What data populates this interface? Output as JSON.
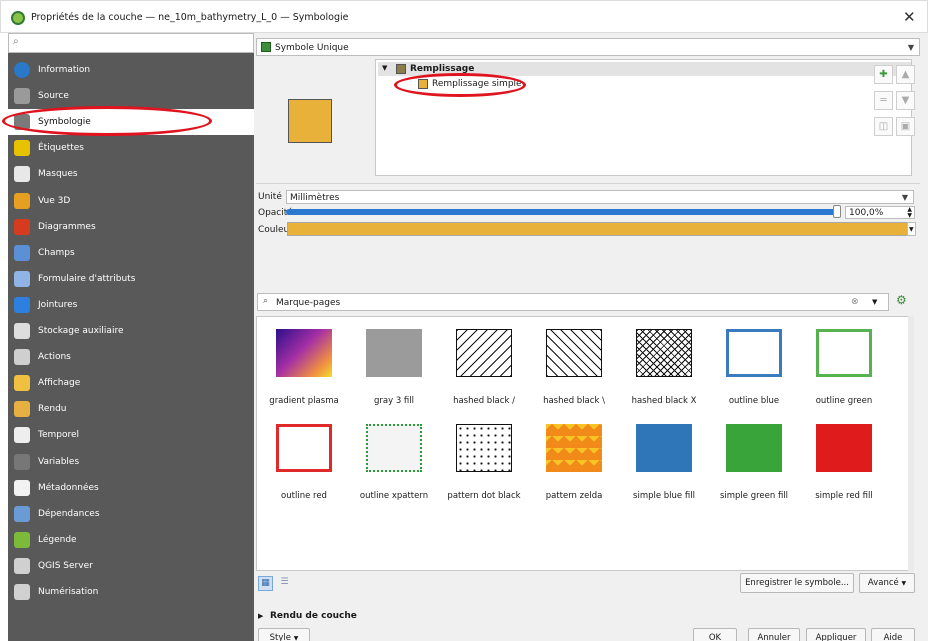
{
  "window": {
    "title": "Propriétés de la couche — ne_10m_bathymetry_L_0 — Symbologie",
    "close_glyph": "✕"
  },
  "sidebar": {
    "search_placeholder": "",
    "items": [
      {
        "label": "Information",
        "icon": "info-icon",
        "color": "#2a78c8"
      },
      {
        "label": "Source",
        "icon": "source-icon",
        "color": "#9a9a9a"
      },
      {
        "label": "Symbologie",
        "icon": "brush-icon",
        "color": "#7a7a7a",
        "selected": true
      },
      {
        "label": "Étiquettes",
        "icon": "labels-icon",
        "color": "#e6c200"
      },
      {
        "label": "Masques",
        "icon": "masks-icon",
        "color": "#e8e8e8"
      },
      {
        "label": "Vue 3D",
        "icon": "cube-icon",
        "color": "#e5a021"
      },
      {
        "label": "Diagrammes",
        "icon": "diagram-icon",
        "color": "#d63b1f"
      },
      {
        "label": "Champs",
        "icon": "fields-icon",
        "color": "#5b8fd6"
      },
      {
        "label": "Formulaire d'attributs",
        "icon": "form-icon",
        "color": "#8fb4e5"
      },
      {
        "label": "Jointures",
        "icon": "joins-icon",
        "color": "#2d7fe0"
      },
      {
        "label": "Stockage auxiliaire",
        "icon": "storage-icon",
        "color": "#dddddd"
      },
      {
        "label": "Actions",
        "icon": "actions-icon",
        "color": "#cfcfcf"
      },
      {
        "label": "Affichage",
        "icon": "display-icon",
        "color": "#f0c040"
      },
      {
        "label": "Rendu",
        "icon": "render-icon",
        "color": "#e6b042"
      },
      {
        "label": "Temporel",
        "icon": "clock-icon",
        "color": "#eeeeee"
      },
      {
        "label": "Variables",
        "icon": "variables-icon",
        "color": "#777777"
      },
      {
        "label": "Métadonnées",
        "icon": "metadata-icon",
        "color": "#f2f2f2"
      },
      {
        "label": "Dépendances",
        "icon": "dependencies-icon",
        "color": "#6a9bd4"
      },
      {
        "label": "Légende",
        "icon": "legend-icon",
        "color": "#7cbb3a"
      },
      {
        "label": "QGIS Server",
        "icon": "server-icon",
        "color": "#d0d0d0"
      },
      {
        "label": "Numérisation",
        "icon": "digitizing-icon",
        "color": "#d0d0d0"
      }
    ]
  },
  "renderer": {
    "type_label": "Symbole Unique",
    "tree_root": "Remplissage",
    "tree_child": "Remplissage simple",
    "fill_color": "#e8b23a"
  },
  "props": {
    "unit_label": "Unité",
    "unit_value": "Millimètres",
    "opacity_label": "Opacité",
    "opacity_value": "100,0%",
    "opacity_fraction": 1.0,
    "color_label": "Couleur",
    "color_value": "#e8b23a"
  },
  "library": {
    "search_placeholder": "Marque-pages",
    "symbols": [
      {
        "name": "gradient  plasma",
        "style": "gradient-plasma"
      },
      {
        "name": "gray 3 fill",
        "style": "gray"
      },
      {
        "name": "hashed black /",
        "style": "hash-fwd"
      },
      {
        "name": "hashed black \\",
        "style": "hash-back"
      },
      {
        "name": "hashed black X",
        "style": "hash-x"
      },
      {
        "name": "outline blue",
        "style": "outline-blue"
      },
      {
        "name": "outline green",
        "style": "outline-green"
      },
      {
        "name": "outline red",
        "style": "outline-red"
      },
      {
        "name": "outline xpattern",
        "style": "outline-xpattern"
      },
      {
        "name": "pattern dot black",
        "style": "dots"
      },
      {
        "name": "pattern zelda",
        "style": "zelda"
      },
      {
        "name": "simple blue fill",
        "style": "blue"
      },
      {
        "name": "simple green fill",
        "style": "green"
      },
      {
        "name": "simple red fill",
        "style": "red"
      }
    ],
    "save_symbol": "Enregistrer le symbole...",
    "advanced": "Avancé"
  },
  "footer": {
    "layer_rendering": "Rendu de couche",
    "style": "Style",
    "ok": "OK",
    "cancel": "Annuler",
    "apply": "Appliquer",
    "help": "Aide"
  }
}
